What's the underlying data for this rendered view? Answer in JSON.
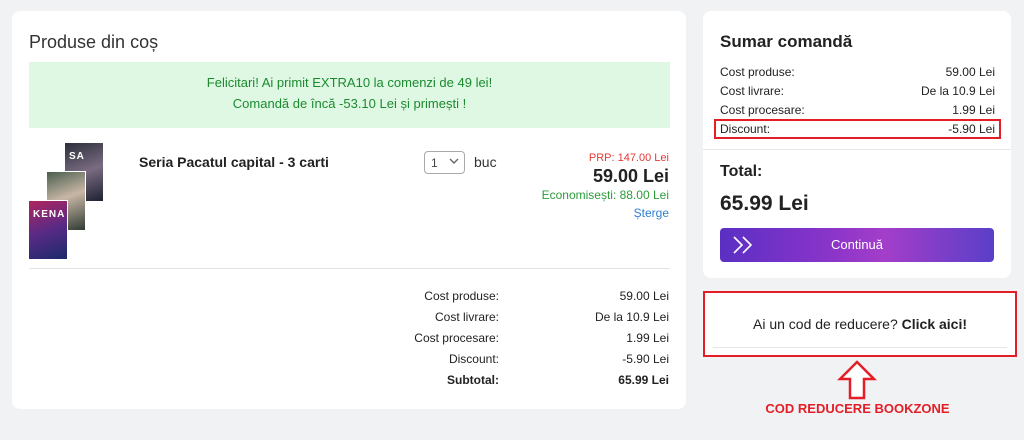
{
  "cart": {
    "title": "Produse din coș",
    "promo": {
      "line1": "Felicitari! Ai primit EXTRA10 la comenzi de 49 lei!",
      "line2": "Comandă de încă -53.10 Lei și primești !"
    },
    "item": {
      "name": "Seria Pacatul capital - 3 carti",
      "quantity": "1",
      "unit": "buc",
      "prp": "PRP: 147.00 Lei",
      "price": "59.00 Lei",
      "savings": "Economisești: 88.00 Lei",
      "delete_label": "Șterge",
      "cover_texts": [
        "SA",
        "",
        "KENA"
      ]
    },
    "totals": [
      {
        "label": "Cost produse:",
        "value": "59.00 Lei"
      },
      {
        "label": "Cost livrare:",
        "value": "De la 10.9 Lei"
      },
      {
        "label": "Cost procesare:",
        "value": "1.99 Lei"
      },
      {
        "label": "Discount:",
        "value": "-5.90 Lei"
      },
      {
        "label": "Subtotal:",
        "value": "65.99 Lei"
      }
    ]
  },
  "summary": {
    "title": "Sumar comandă",
    "rows": [
      {
        "label": "Cost produse:",
        "value": "59.00 Lei"
      },
      {
        "label": "Cost livrare:",
        "value": "De la 10.9 Lei"
      },
      {
        "label": "Cost procesare:",
        "value": "1.99 Lei"
      },
      {
        "label": "Discount:",
        "value": "-5.90 Lei"
      }
    ],
    "total_label": "Total:",
    "total_value": "65.99 Lei",
    "continue_label": "Continuă"
  },
  "coupon": {
    "prompt": "Ai un cod de reducere?",
    "link": "Click aici!"
  },
  "annotation": {
    "label": "COD REDUCERE BOOKZONE"
  },
  "colors": {
    "highlight": "#e41e26",
    "promo_bg": "#dff8e3",
    "promo_text": "#1b8a2f",
    "accent_purple": "#8a34c9"
  }
}
